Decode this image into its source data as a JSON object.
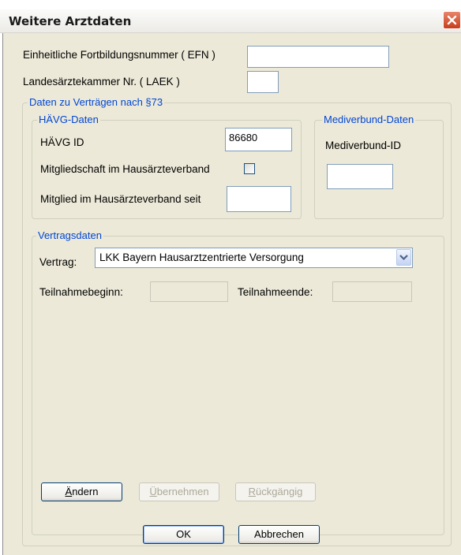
{
  "window": {
    "title": "Weitere Arztdaten"
  },
  "efn": {
    "label": "Einheitliche Fortbildungsnummer ( EFN )",
    "value": ""
  },
  "laek": {
    "label": "Landesärztekammer Nr. ( LAEK )",
    "value": ""
  },
  "vertraege_group": {
    "title": "Daten zu Verträgen nach §73"
  },
  "haevg": {
    "title": "HÄVG-Daten",
    "id_label": "HÄVG ID",
    "id_value": "86680",
    "mitgliedschaft_label": "Mitgliedschaft im Hausärzteverband",
    "mitgliedschaft_checked": false,
    "seit_label": "Mitglied im Hausärzteverband seit",
    "seit_value": ""
  },
  "mediverbund": {
    "title": "Mediverbund-Daten",
    "id_label": "Mediverbund-ID",
    "id_value": ""
  },
  "vertragsdaten": {
    "title": "Vertragsdaten",
    "vertrag_label": "Vertrag:",
    "vertrag_value": "LKK Bayern Hausarztzentrierte Versorgung",
    "beginn_label": "Teilnahmebeginn:",
    "beginn_value": "",
    "ende_label": "Teilnahmeende:",
    "ende_value": ""
  },
  "buttons": {
    "aendern_first": "Ä",
    "aendern_rest": "ndern",
    "uebernehmen_first": "Ü",
    "uebernehmen_rest": "bernehmen",
    "rueck_first": "R",
    "rueck_rest": "ückgängig",
    "ok": "OK",
    "abbrechen": "Abbrechen"
  },
  "icons": {
    "close": "close-icon",
    "dropdown": "chevron-down-icon",
    "checkbox": "checkbox"
  },
  "colors": {
    "group_title": "#0046d5",
    "close_button": "#c73d1c",
    "dialog_face": "#ece9d8"
  }
}
